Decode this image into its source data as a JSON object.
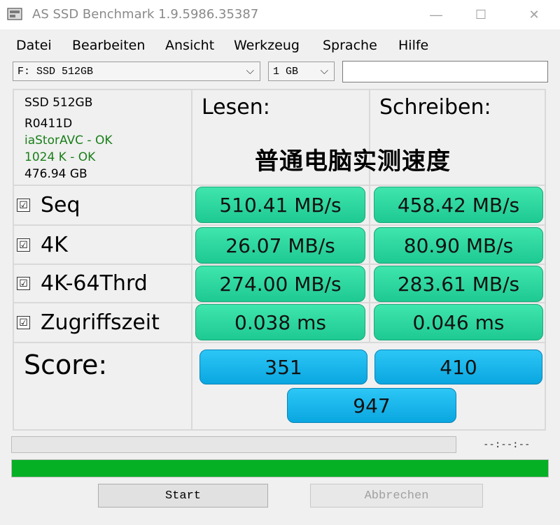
{
  "window": {
    "title": "AS SSD Benchmark 1.9.5986.35387",
    "minimize_glyph": "—",
    "maximize_glyph": "☐",
    "close_glyph": "✕"
  },
  "menu": [
    "Datei",
    "Bearbeiten",
    "Ansicht",
    "Werkzeug",
    "Sprache",
    "Hilfe"
  ],
  "selectors": {
    "drive": "F: SSD 512GB",
    "size": "1 GB",
    "free_input_value": ""
  },
  "drive_info": {
    "model": "SSD 512GB",
    "firmware": "R0411D",
    "driver_status": "iaStorAVC - OK",
    "alignment_status": "1024 K - OK",
    "capacity": "476.94 GB"
  },
  "columns": {
    "read": "Lesen:",
    "write": "Schreiben:"
  },
  "watermark": "普通电脑实测速度",
  "tests": [
    {
      "name": "Seq",
      "checked": "☑",
      "read": "510.41 MB/s",
      "write": "458.42 MB/s"
    },
    {
      "name": "4K",
      "checked": "☑",
      "read": "26.07 MB/s",
      "write": "80.90 MB/s"
    },
    {
      "name": "4K-64Thrd",
      "checked": "☑",
      "read": "274.00 MB/s",
      "write": "283.61 MB/s"
    },
    {
      "name": "Zugriffszeit",
      "checked": "☑",
      "read": "0.038 ms",
      "write": "0.046 ms"
    }
  ],
  "score": {
    "label": "Score:",
    "read": "351",
    "write": "410",
    "total": "947"
  },
  "progress": {
    "time_text": "--:--:--",
    "main_fraction": 1.0
  },
  "buttons": {
    "start": "Start",
    "abort": "Abbrechen"
  },
  "colors": {
    "result_green": "#2ad9a0",
    "score_blue": "#14b4ec",
    "progress_green": "#06b025",
    "ok_text": "#1a7f1a"
  }
}
